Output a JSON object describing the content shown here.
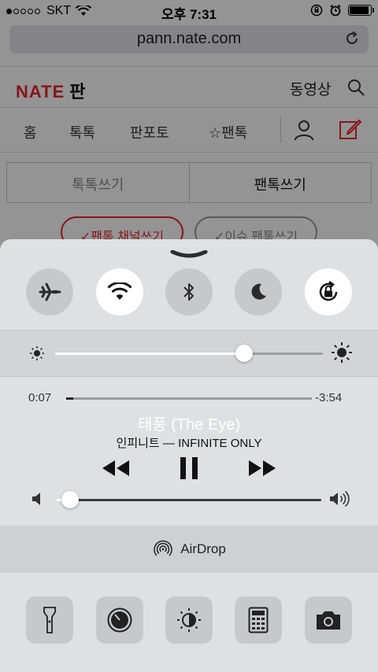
{
  "status_bar": {
    "carrier": "SKT",
    "time": "오후 7:31"
  },
  "browser": {
    "url": "pann.nate.com"
  },
  "site": {
    "logo": "NATE",
    "logo_sub": "판",
    "video_link": "동영상",
    "nav": [
      "홈",
      "톡톡",
      "판포토",
      "☆팬톡"
    ],
    "write_tabs": [
      "톡톡쓰기",
      "팬톡쓰기"
    ],
    "pills": [
      "✓팬톡 채널쓰기",
      "✓이슈 팬톡쓰기"
    ]
  },
  "control_center": {
    "toggles": [
      {
        "icon": "airplane-icon",
        "on": false
      },
      {
        "icon": "wifi-icon",
        "on": true
      },
      {
        "icon": "bluetooth-icon",
        "on": false
      },
      {
        "icon": "moon-icon",
        "on": false
      },
      {
        "icon": "rotation-lock-icon",
        "on": true
      }
    ],
    "brightness": 0.72,
    "media": {
      "elapsed": "0:07",
      "remaining": "-3:54",
      "progress": 0.03,
      "title": "태풍 (The Eye)",
      "artist_album": "인피니트 — INFINITE ONLY",
      "volume": 0.02
    },
    "airdrop_label": "AirDrop",
    "shortcuts": [
      "flashlight-icon",
      "timer-icon",
      "night-shift-icon",
      "calculator-icon",
      "camera-icon"
    ]
  }
}
